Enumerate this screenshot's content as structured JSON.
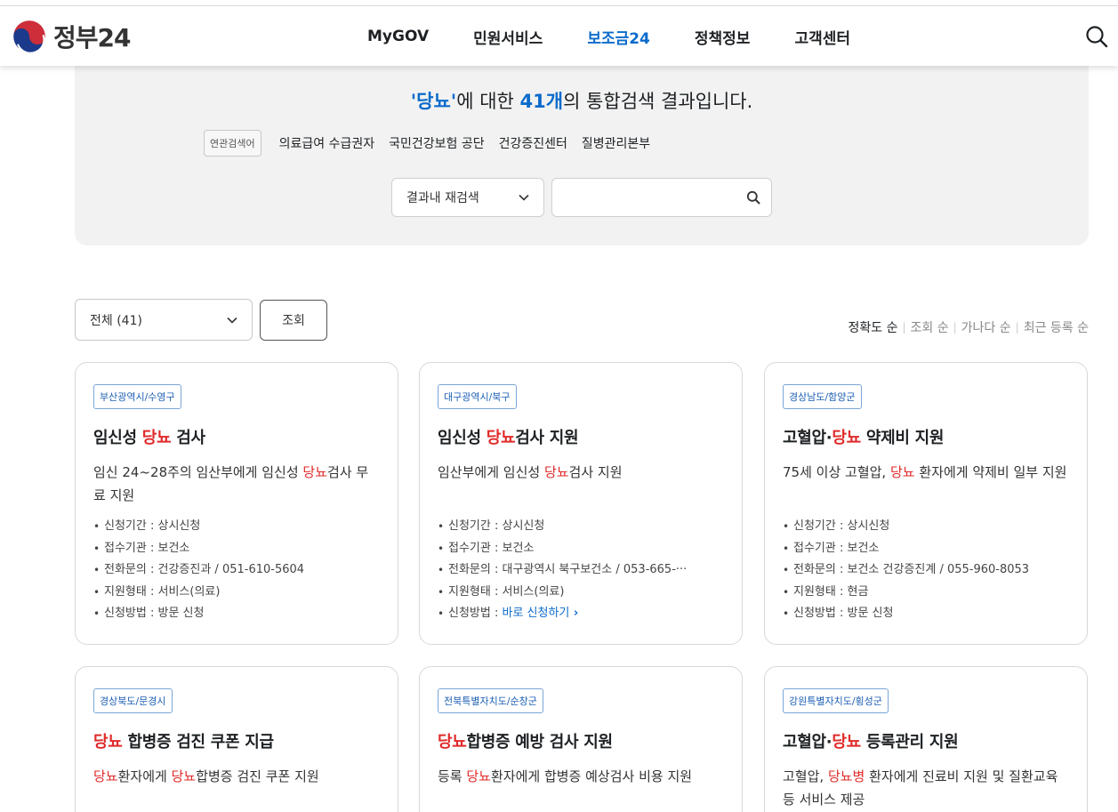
{
  "header": {
    "logo_text": "정부24",
    "nav": [
      "MyGOV",
      "민원서비스",
      "보조금24",
      "정책정보",
      "고객센터"
    ],
    "active_nav": "보조금24"
  },
  "summary": {
    "query": "'당뇨'",
    "title_mid": "에 대한 ",
    "count": "41개",
    "title_tail": "의 통합검색 결과입니다.",
    "related_label": "연관검색어",
    "related_keywords": [
      "의료급여 수급권자",
      "국민건강보험 공단",
      "건강증진센터",
      "질병관리본부"
    ],
    "refine_select": "결과내 재검색",
    "refine_input_value": ""
  },
  "filter": {
    "category_select": "전체 (41)",
    "view_button": "조회",
    "sort": [
      "정확도 순",
      "조회 순",
      "가나다 순",
      "최근 등록 순"
    ],
    "active_sort": "정확도 순"
  },
  "cards": [
    {
      "tag": "부산광역시/수영구",
      "title": [
        {
          "t": "임신성 "
        },
        {
          "t": "당뇨",
          "r": true
        },
        {
          "t": " 검사"
        }
      ],
      "desc": [
        {
          "t": "임신 24~28주의 임산부에게 임신성 "
        },
        {
          "t": "당뇨",
          "r": true
        },
        {
          "t": "검사 무료 지원"
        }
      ],
      "details": [
        {
          "label": "신청기간 : ",
          "value": "상시신청"
        },
        {
          "label": "접수기관 : ",
          "value": "보건소"
        },
        {
          "label": "전화문의 : ",
          "value": "건강증진과 / 051-610-5604"
        },
        {
          "label": "지원형태 : ",
          "value": "서비스(의료)"
        },
        {
          "label": "신청방법 : ",
          "value": "방문 신청"
        }
      ]
    },
    {
      "tag": "대구광역시/북구",
      "title": [
        {
          "t": "임신성 "
        },
        {
          "t": "당뇨",
          "r": true
        },
        {
          "t": "검사 지원"
        }
      ],
      "desc": [
        {
          "t": "임산부에게 임신성 "
        },
        {
          "t": "당뇨",
          "r": true
        },
        {
          "t": "검사 지원"
        }
      ],
      "details": [
        {
          "label": "신청기간 : ",
          "value": "상시신청"
        },
        {
          "label": "접수기관 : ",
          "value": "보건소"
        },
        {
          "label": "전화문의 : ",
          "value": "대구광역시 북구보건소 / 053-665-···"
        },
        {
          "label": "지원형태 : ",
          "value": "서비스(의료)"
        },
        {
          "label": "신청방법 : ",
          "value": "바로 신청하기",
          "link": true
        }
      ]
    },
    {
      "tag": "경상남도/함양군",
      "title": [
        {
          "t": "고혈압·"
        },
        {
          "t": "당뇨",
          "r": true
        },
        {
          "t": " 약제비 지원"
        }
      ],
      "desc": [
        {
          "t": "75세 이상 고혈압, "
        },
        {
          "t": "당뇨",
          "r": true
        },
        {
          "t": " 환자에게 약제비 일부 지원"
        }
      ],
      "details": [
        {
          "label": "신청기간 : ",
          "value": "상시신청"
        },
        {
          "label": "접수기관 : ",
          "value": "보건소"
        },
        {
          "label": "전화문의 : ",
          "value": "보건소 건강증진계 / 055-960-8053"
        },
        {
          "label": "지원형태 : ",
          "value": "현금"
        },
        {
          "label": "신청방법 : ",
          "value": "방문 신청"
        }
      ]
    },
    {
      "tag": "경상북도/문경시",
      "title": [
        {
          "t": "당뇨",
          "r": true
        },
        {
          "t": " 합병증 검진 쿠폰 지급"
        }
      ],
      "desc": [
        {
          "t": "당뇨",
          "r": true
        },
        {
          "t": "환자에게 "
        },
        {
          "t": "당뇨",
          "r": true
        },
        {
          "t": "합병증 검진 쿠폰 지원"
        }
      ],
      "details": []
    },
    {
      "tag": "전북특별자치도/순창군",
      "title": [
        {
          "t": "당뇨",
          "r": true
        },
        {
          "t": "합병증 예방 검사 지원"
        }
      ],
      "desc": [
        {
          "t": "등록 "
        },
        {
          "t": "당뇨",
          "r": true
        },
        {
          "t": "환자에게 합병증 예상검사 비용 지원"
        }
      ],
      "details": []
    },
    {
      "tag": "강원특별자치도/횡성군",
      "title": [
        {
          "t": "고혈압·"
        },
        {
          "t": "당뇨",
          "r": true
        },
        {
          "t": " 등록관리 지원"
        }
      ],
      "desc": [
        {
          "t": "고혈압, "
        },
        {
          "t": "당뇨병",
          "r": true
        },
        {
          "t": " 환자에게 진료비 지원 및 질환교육 등 서비스 제공"
        }
      ],
      "details": []
    }
  ],
  "colors": {
    "accent": "#0b6bcb",
    "highlight": "#e02a2a",
    "panel_bg": "#f2f2f2"
  }
}
